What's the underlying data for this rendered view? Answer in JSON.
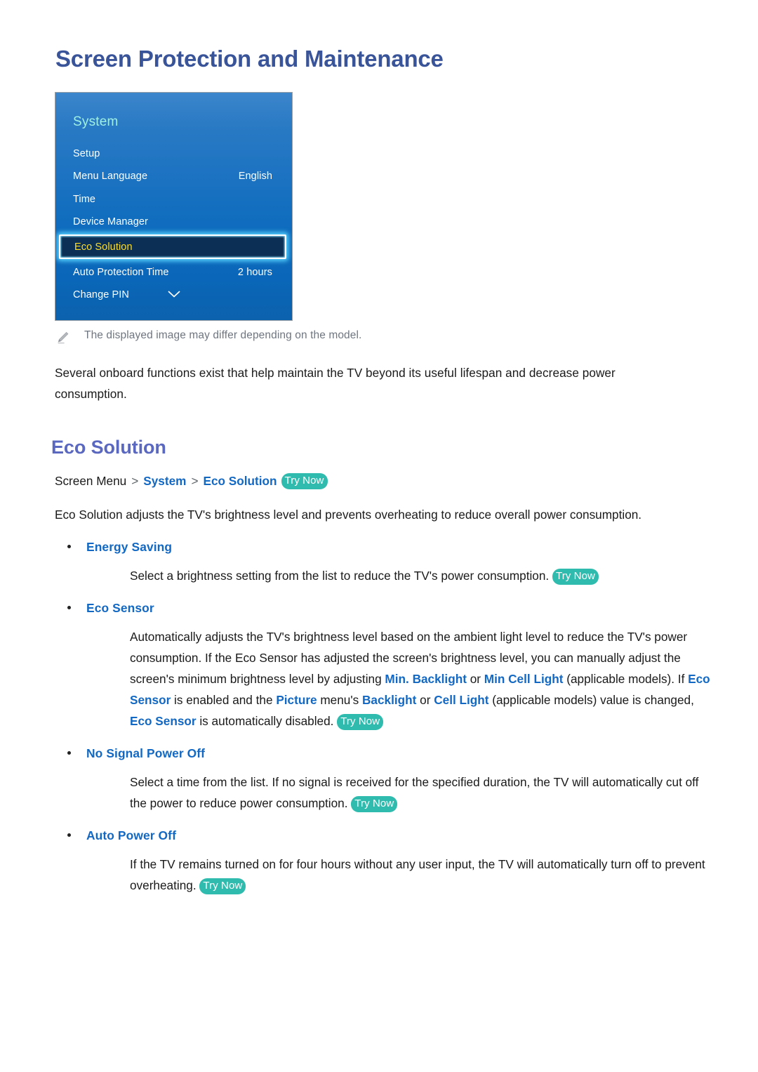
{
  "page": {
    "title": "Screen Protection and Maintenance"
  },
  "tv_menu": {
    "header": "System",
    "rows": [
      {
        "label": "Setup",
        "value": ""
      },
      {
        "label": "Menu Language",
        "value": "English"
      },
      {
        "label": "Time",
        "value": ""
      },
      {
        "label": "Device Manager",
        "value": ""
      },
      {
        "label": "Eco Solution",
        "value": "",
        "selected": true
      },
      {
        "label": "Auto Protection Time",
        "value": "2 hours"
      },
      {
        "label": "Change PIN",
        "value": ""
      }
    ],
    "scroll_hint_icon": "chevron-down-icon",
    "colors": {
      "panel_top": "#3c86cc",
      "panel_bottom": "#0c62ad",
      "header_text": "#9ff0e4",
      "selected_fill": "#0c2f55",
      "selected_text": "#ffdd22",
      "selected_glow": "#59d4ff"
    }
  },
  "note": {
    "icon": "pencil-icon",
    "text": "The displayed image may differ depending on the model."
  },
  "intro_paragraph": "Several onboard functions exist that help maintain the TV beyond its useful lifespan and decrease power consumption.",
  "section": {
    "title": "Eco Solution",
    "breadcrumb": {
      "root": "Screen Menu",
      "separator": ">",
      "link1": "System",
      "link2": "Eco Solution",
      "try_now": "Try Now"
    },
    "description": "Eco Solution adjusts the TV's brightness level and prevents overheating to reduce overall power consumption.",
    "bullets": [
      {
        "label": "Energy Saving",
        "body_parts": [
          {
            "t": "Select a brightness setting from the list to reduce the TV's power consumption."
          }
        ],
        "try_now": "Try Now"
      },
      {
        "label": "Eco Sensor",
        "body_parts": [
          {
            "t": "Automatically adjusts the TV's brightness level based on the ambient light level to reduce the TV's power consumption. If the Eco Sensor has adjusted the screen's brightness level, you can manually adjust the screen's minimum brightness level by adjusting "
          },
          {
            "t": "Min. Backlight",
            "kw": true
          },
          {
            "t": " or "
          },
          {
            "t": "Min Cell Light",
            "kw": true
          },
          {
            "t": " (applicable models). If "
          },
          {
            "t": "Eco Sensor",
            "kw": true
          },
          {
            "t": " is enabled and the "
          },
          {
            "t": "Picture",
            "kw": true
          },
          {
            "t": " menu's "
          },
          {
            "t": "Backlight",
            "kw": true
          },
          {
            "t": " or "
          },
          {
            "t": "Cell Light",
            "kw": true
          },
          {
            "t": " (applicable models) value is changed, "
          },
          {
            "t": "Eco Sensor",
            "kw": true
          },
          {
            "t": " is automatically disabled."
          }
        ],
        "try_now": "Try Now"
      },
      {
        "label": "No Signal Power Off",
        "body_parts": [
          {
            "t": "Select a time from the list. If no signal is received for the specified duration, the TV will automatically cut off the power to reduce power consumption."
          }
        ],
        "try_now": "Try Now"
      },
      {
        "label": "Auto Power Off",
        "body_parts": [
          {
            "t": "If the TV remains turned on for four hours without any user input, the TV will automatically turn off to prevent overheating."
          }
        ],
        "try_now": "Try Now"
      }
    ]
  },
  "colors": {
    "title": "#3a5499",
    "section_title": "#5a68c0",
    "link_blue": "#1268c3",
    "try_now_teal": "#2fbcae",
    "note_grey": "#6f7680"
  }
}
